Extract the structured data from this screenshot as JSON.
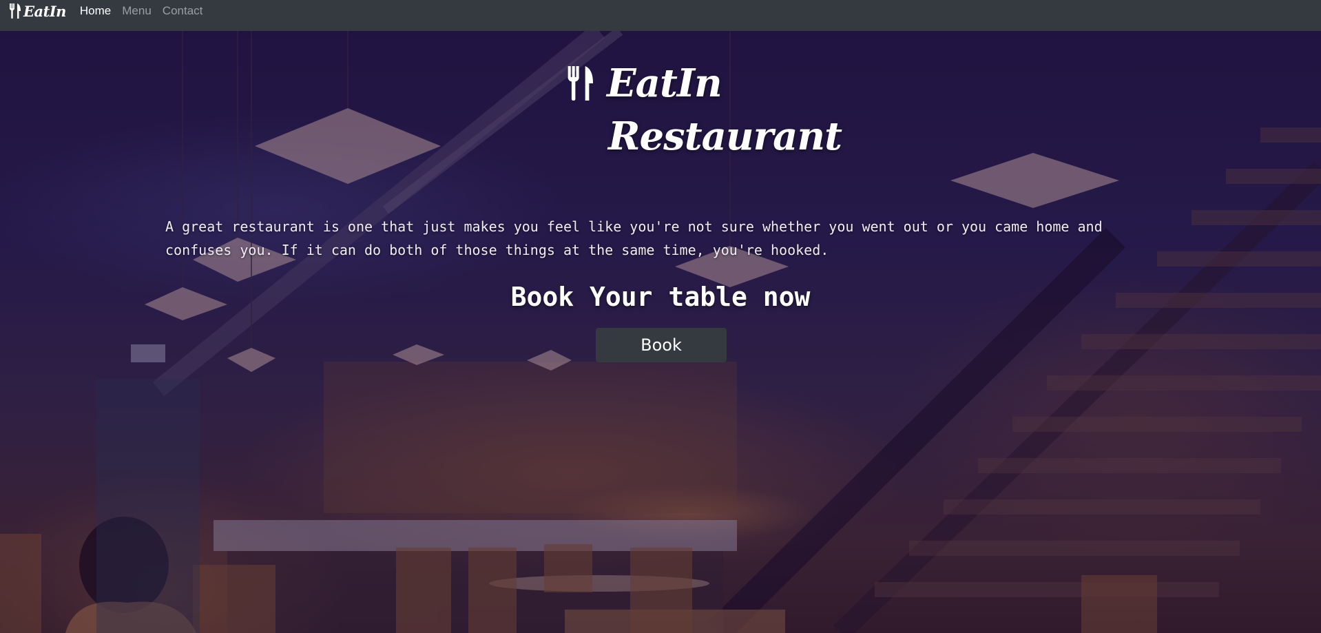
{
  "navbar": {
    "brand": "EatIn",
    "brand_icon": "utensils-icon",
    "links": [
      {
        "label": "Home",
        "active": true
      },
      {
        "label": "Menu",
        "active": false
      },
      {
        "label": "Contact",
        "active": false
      }
    ]
  },
  "hero": {
    "title_line1": "EatIn",
    "title_line2": "Restaurant",
    "title_icon": "utensils-icon",
    "quote": "A great restaurant is one that just makes you feel like you're not sure whether you went out or you came home and confuses you. If it can do both of those things at the same time, you're hooked.",
    "cta_heading": "Book Your table now",
    "cta_button": "Book",
    "background_image": "restaurant-interior-photo"
  },
  "colors": {
    "navbar_bg": "#343a40",
    "button_bg": "#343a40",
    "overlay": "#1e0a3c",
    "text": "#ffffff"
  }
}
